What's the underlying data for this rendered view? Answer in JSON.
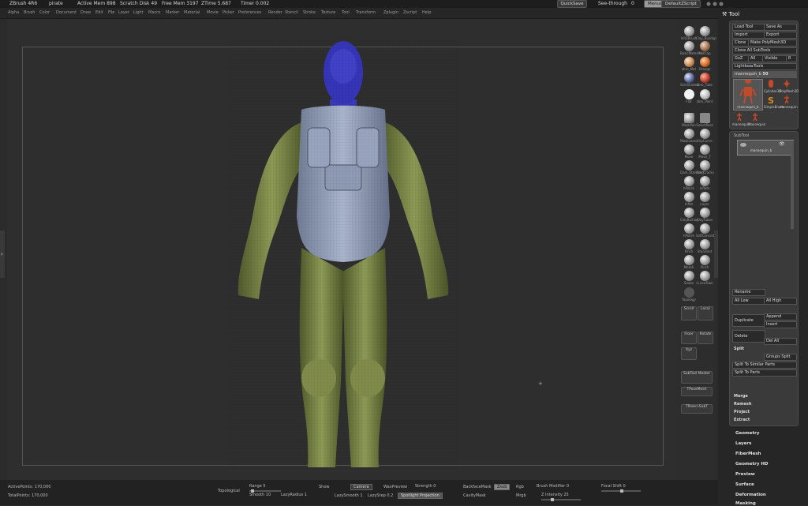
{
  "title": {
    "app": "ZBrush 4R6",
    "document": "pirate",
    "active_mem": "Active Mem 898",
    "scratch_disk": "Scratch Disk 49",
    "free_mem": "Free Mem 3197",
    "ztime": "ZTime 5.687",
    "timer": "Timer 0.002",
    "quicksave": "QuickSave",
    "see_through_label": "See-through",
    "see_through_value": "0",
    "menus": "Menus",
    "script": "DefaultZScript"
  },
  "menus": [
    "Alpha",
    "Brush",
    "Color",
    "Document",
    "Draw",
    "Edit",
    "File",
    "Layer",
    "Light",
    "Macro",
    "Marker",
    "Material",
    "Movie",
    "Picker",
    "Preferences",
    "Render",
    "Stencil",
    "Stroke",
    "Texture",
    "Tool",
    "Transform",
    "Zplugin",
    "Zscript",
    "Help"
  ],
  "brushes": [
    [
      "InitZBrush",
      "Clay_Buildup"
    ],
    [
      "BasicMaterial",
      "MatCap"
    ],
    [
      "zbro_Mat",
      "Orange"
    ],
    [
      "SkinShade4",
      "zbro_Tube"
    ],
    [
      "Flat",
      "zbro_Paint"
    ],
    [
      "MaskPen",
      "SelectRect"
    ],
    [
      "MaskLasso",
      "ClipCurve"
    ],
    [
      "Move",
      "Move_T"
    ],
    [
      "Dam_Standard",
      "Orb_Cracks"
    ],
    [
      "hPolish",
      "Inflate"
    ],
    [
      "Inflat",
      "Layer"
    ],
    [
      "ClayBuildup",
      "ClayTubes"
    ],
    [
      "hPolish",
      "SoftConcrete"
    ],
    [
      "Pinch",
      "Standard"
    ],
    [
      "Morph",
      "Pinch"
    ],
    [
      "Snake",
      "CurveTube"
    ],
    [
      "Topology",
      ""
    ]
  ],
  "brush_controls": {
    "scroll": "Scroll",
    "local": "Local",
    "floor": "Floor",
    "xyz": "Xyz",
    "rotate": "Rotate",
    "subtool_master": "SubTool Master",
    "tpose_mesh": "TPoseMesh",
    "tpose_sub": "TPose>SubT"
  },
  "tool_panel": {
    "header": "Tool",
    "load": "Load Tool",
    "save_as": "Save As",
    "import": "Import",
    "export": "Export",
    "clone": "Clone",
    "make_polymesh": "Make PolyMesh3D",
    "clone_all": "Clone All SubTools",
    "goz": "GoZ",
    "all": "All",
    "visible": "Visible",
    "r": "R",
    "lightbox_tools": "Lightbox▸Tools",
    "current_tool": "mannequin_b",
    "current_value": "50",
    "thumbs": [
      "mannequin_b",
      "Cylinder3D",
      "PolyMesh3D",
      "SimpleBrush",
      "mannequin",
      "mannequin",
      "Mannequin"
    ]
  },
  "subtool": {
    "header": "SubTool",
    "item": "mannequin_b",
    "rename": "Rename",
    "all_low": "All Low",
    "all_high": "All High",
    "duplicate": "Duplicate",
    "append": "Append",
    "insert": "Insert",
    "delete": "Delete",
    "del_all": "Del All",
    "split": "Split",
    "groups_split": "Groups Split",
    "split_similar": "Split To Similar Parts",
    "split_parts": "Split To Parts",
    "merge": "Merge",
    "remesh": "Remesh",
    "project": "Project",
    "extract": "Extract"
  },
  "sections": [
    "Geometry",
    "Layers",
    "FiberMesh",
    "Geometry HD",
    "Preview",
    "Surface",
    "Deformation",
    "Masking"
  ],
  "bottom": {
    "active_points": "ActivePoints: 170,000",
    "total_points": "TotalPoints: 170,000",
    "topological": "Topological",
    "range": "Range 5",
    "smooth": "Smooth 10",
    "lazy_radius": "LazyRadius 1",
    "show": "Show",
    "camera": "Camera",
    "wax_preview": "WaxPreview",
    "strength": "Strength 0",
    "lazy_smooth": "LazySmooth 1",
    "lazy_step": "LazyStep 0.2",
    "spotlight_projection": "Spotlight Projection",
    "backfacemask": "BackfaceMask",
    "cavitymask": "CavityMask",
    "zsub": "Zsub",
    "rgb": "Rgb",
    "mrgb": "Mrgb",
    "brush_modifier": "Brush Modifier 0",
    "z_intensity": "Z Intensity 25",
    "focal_shift": "Focal Shift 0"
  }
}
